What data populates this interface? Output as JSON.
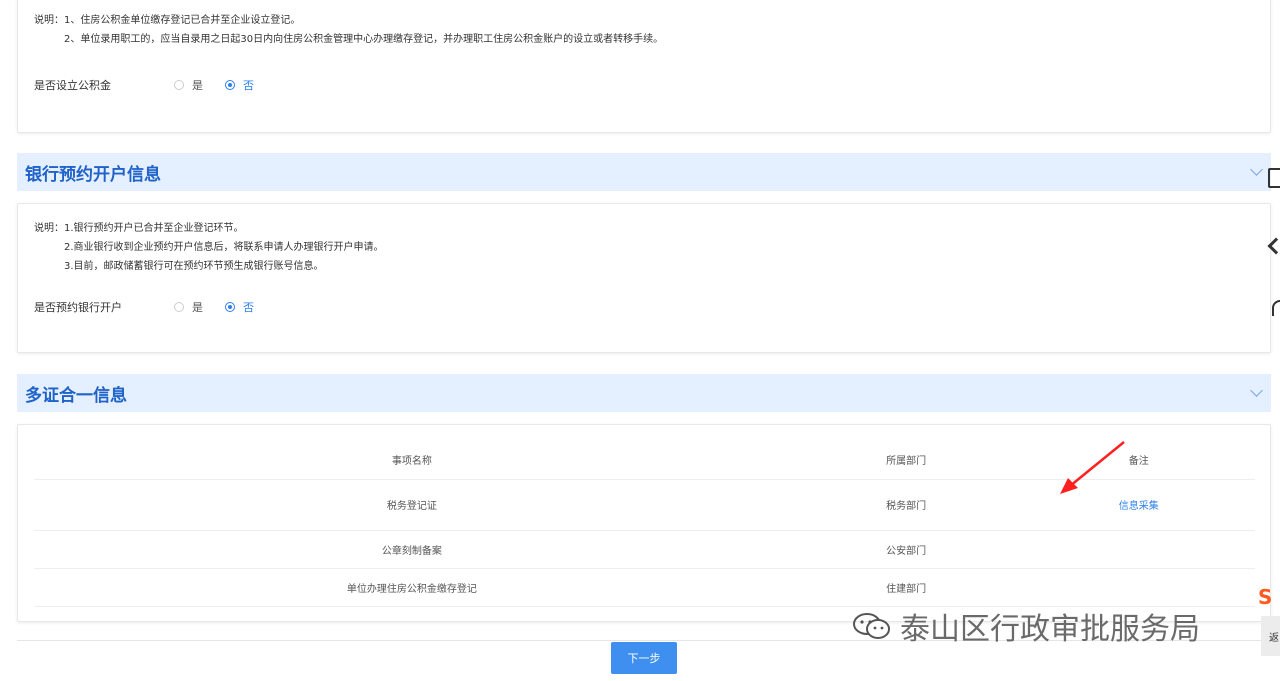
{
  "fund_section": {
    "note_line1": "说明：1、住房公积金单位缴存登记已合并至企业设立登记。",
    "note_line2": "2、单位录用职工的，应当自录用之日起30日内向住房公积金管理中心办理缴存登记，并办理职工住房公积金账户的设立或者转移手续。",
    "question": "是否设立公积金",
    "option_yes": "是",
    "option_no": "否",
    "selected": "否"
  },
  "bank_section": {
    "title": "银行预约开户信息",
    "note_line1": "说明：1.银行预约开户已合并至企业登记环节。",
    "note_line2": "2.商业银行收到企业预约开户信息后，将联系申请人办理银行开户申请。",
    "note_line3": "3.目前，邮政储蓄银行可在预约环节预生成银行账号信息。",
    "question": "是否预约银行开户",
    "option_yes": "是",
    "option_no": "否",
    "selected": "否"
  },
  "multi_cert_section": {
    "title": "多证合一信息",
    "columns": [
      "事项名称",
      "所属部门",
      "备注"
    ],
    "rows": [
      {
        "name": "税务登记证",
        "dept": "税务部门",
        "remark": "信息采集"
      },
      {
        "name": "公章刻制备案",
        "dept": "公安部门",
        "remark": ""
      },
      {
        "name": "单位办理住房公积金缴存登记",
        "dept": "住建部门",
        "remark": ""
      }
    ]
  },
  "footer": {
    "next_button": "下一步"
  },
  "watermark": {
    "text": "泰山区行政审批服务局"
  },
  "edge": {
    "back_label": "返",
    "logo_letter": "S"
  },
  "colors": {
    "accent": "#2d7fea",
    "header_bg": "#e4efff",
    "header_text": "#1f62c8",
    "arrow": "#ff2020"
  }
}
